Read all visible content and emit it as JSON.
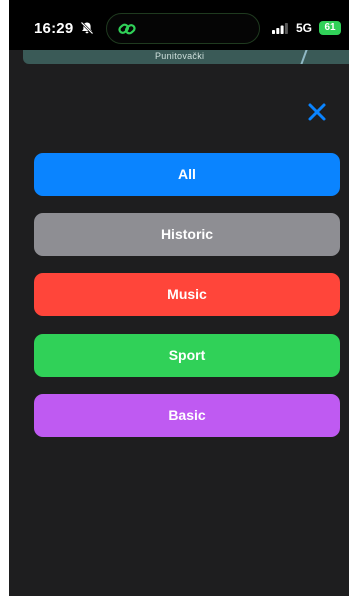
{
  "status_bar": {
    "time": "16:29",
    "network": "5G",
    "battery": "61"
  },
  "map": {
    "street_label": "Punitovački"
  },
  "icons": {
    "bell": "bell-slash-icon",
    "link": "link-icon",
    "signal": "signal-icon",
    "close": "close-icon"
  },
  "filters": [
    {
      "label": "All",
      "color": "#0a84ff"
    },
    {
      "label": "Historic",
      "color": "#8e8e93"
    },
    {
      "label": "Music",
      "color": "#ff453a"
    },
    {
      "label": "Sport",
      "color": "#30d158"
    },
    {
      "label": "Basic",
      "color": "#bf5af2"
    }
  ],
  "colors": {
    "background": "#1e1e1f",
    "close_icon": "#0a84ff"
  }
}
